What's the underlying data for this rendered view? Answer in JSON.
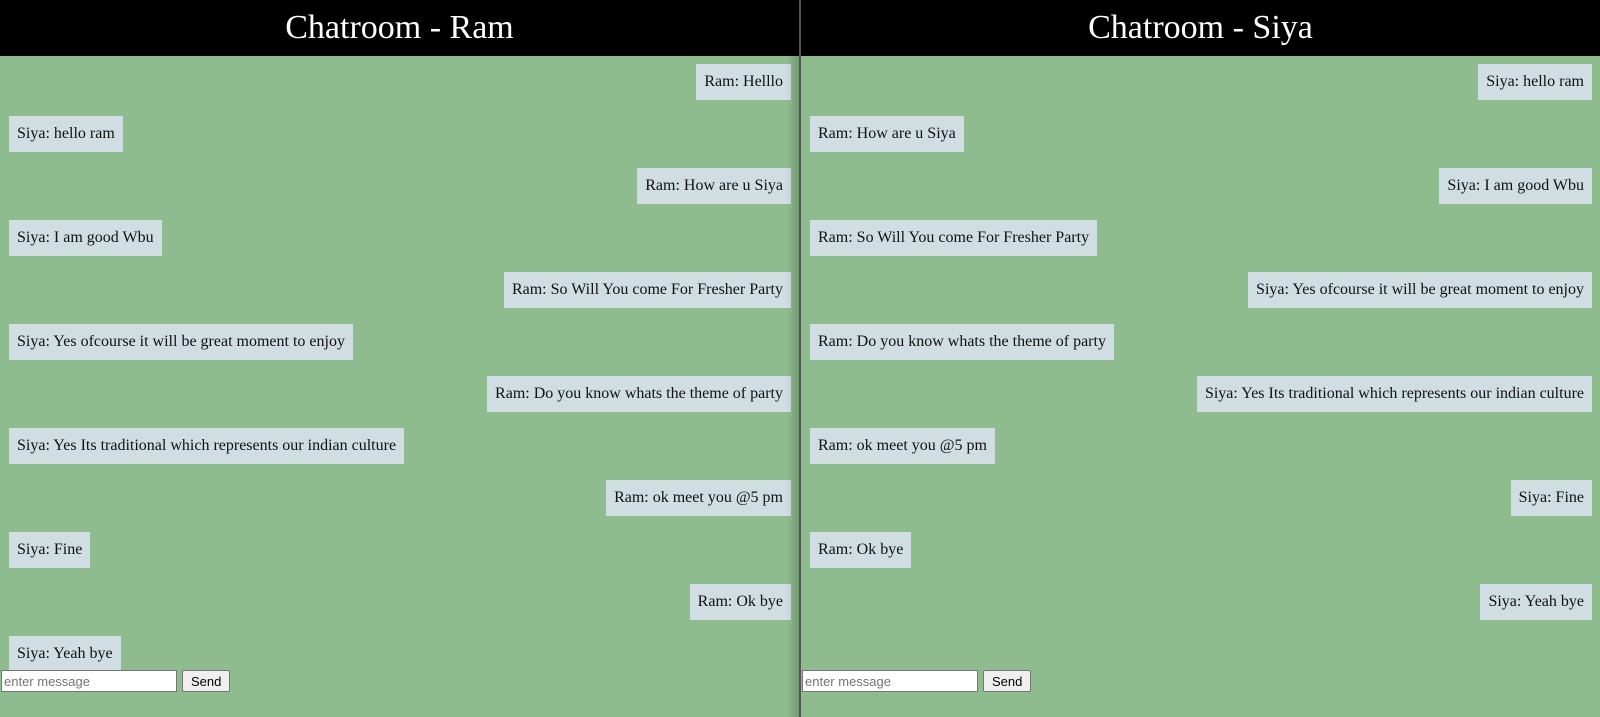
{
  "ram": {
    "title": "Chatroom - Ram",
    "messages": [
      "Ram: Helllo",
      "Siya: hello ram",
      "Ram: How are u Siya",
      "Siya: I am good Wbu",
      "Ram: So Will You come For Fresher Party",
      "Siya: Yes ofcourse it will be great moment to enjoy",
      "Ram: Do you know whats the theme of party",
      "Siya: Yes Its traditional which represents our indian culture",
      "Ram: ok meet you @5 pm",
      "Siya: Fine",
      "Ram: Ok bye",
      "Siya: Yeah bye"
    ],
    "input_placeholder": "enter message",
    "input_value": "",
    "send_label": "Send"
  },
  "siya": {
    "title": "Chatroom - Siya",
    "messages": [
      "Siya: hello ram",
      "Ram: How are u Siya",
      "Siya: I am good Wbu",
      "Ram: So Will You come For Fresher Party",
      "Siya: Yes ofcourse it will be great moment to enjoy",
      "Ram: Do you know whats the theme of party",
      "Siya: Yes Its traditional which represents our indian culture",
      "Ram: ok meet you @5 pm",
      "Siya: Fine",
      "Ram: Ok bye",
      "Siya: Yeah bye"
    ],
    "input_placeholder": "enter message",
    "input_value": "",
    "send_label": "Send"
  },
  "colors": {
    "background": "#8fbc8f",
    "header": "#000000",
    "bubble": "#d0dde2"
  }
}
